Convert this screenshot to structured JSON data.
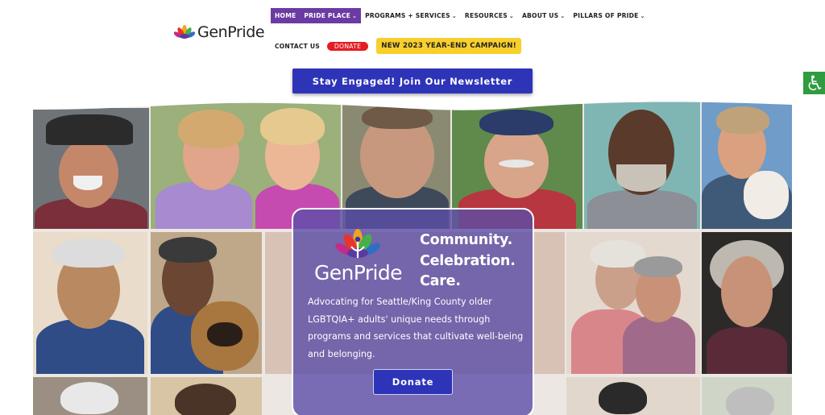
{
  "brand": {
    "name": "GenPride"
  },
  "nav": {
    "row1": [
      {
        "label": "HOME",
        "dropdown": false
      },
      {
        "label": "PRIDE PLACE",
        "dropdown": true
      },
      {
        "label": "PROGRAMS + SERVICES",
        "dropdown": true
      },
      {
        "label": "RESOURCES",
        "dropdown": true
      },
      {
        "label": "ABOUT US",
        "dropdown": true
      },
      {
        "label": "PILLARS OF PRIDE",
        "dropdown": true
      }
    ],
    "contact_label": "CONTACT US",
    "donate_label": "DONATE",
    "campaign_label": "NEW 2023 YEAR-END CAMPAIGN!",
    "caret_glyph": "⌄"
  },
  "newsletter": {
    "label": "Stay Engaged! Join Our Newsletter"
  },
  "accessibility": {
    "icon": "wheelchair-icon"
  },
  "hero": {
    "logo_text": "GenPride",
    "tagline": [
      "Community.",
      "Celebration.",
      "Care."
    ],
    "description": "Advocating for Seattle/King County older LGBTQIA+ adults' unique needs through programs and services that cultivate well-being and belonging.",
    "donate_label": "Donate"
  },
  "colors": {
    "nav_active": "#6b3aa3",
    "button_blue": "#2e34b8",
    "donate_red": "#e41c23",
    "campaign_yellow": "#f8cf2c",
    "accessibility_green": "#2e9c3f",
    "card_overlay": "#5c4ea8"
  }
}
